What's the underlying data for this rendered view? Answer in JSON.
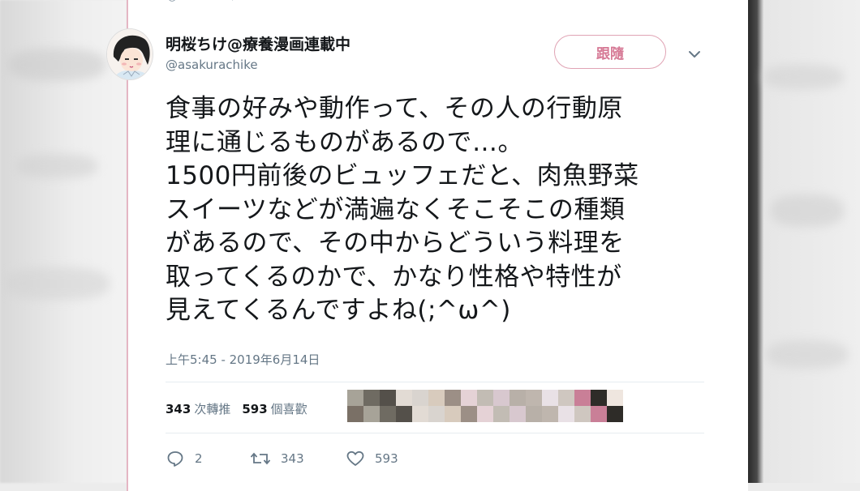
{
  "tweet": {
    "display_name": "明桜ちけ@療養漫画連載中",
    "handle": "@asakurachike",
    "follow_label": "跟隨",
    "text": "食事の好みや動作って、その人の行動原\n理に通じるものがあるので…。\n1500円前後のビュッフェだと、肉魚野菜\nスイーツなどが満遍なくそこそこの種類\nがあるので、その中からどういう料理を\n取ってくるのかで、かなり性格や特性が\n見えてくるんですよね(;^ω^)",
    "timestamp": "上午5:45 - 2019年6月14日",
    "retweet_count": "343",
    "retweet_label": "次轉推",
    "like_count": "593",
    "like_label": "個喜歡",
    "actions": {
      "reply_count": "2",
      "retweet_count": "343",
      "like_count": "593"
    }
  },
  "icons": [
    "avatar",
    "chevron-down-icon",
    "reply-icon",
    "retweet-icon",
    "heart-icon"
  ],
  "colors": {
    "follow_border": "#e0a3b4",
    "follow_text": "#d67995",
    "muted": "#657786"
  }
}
